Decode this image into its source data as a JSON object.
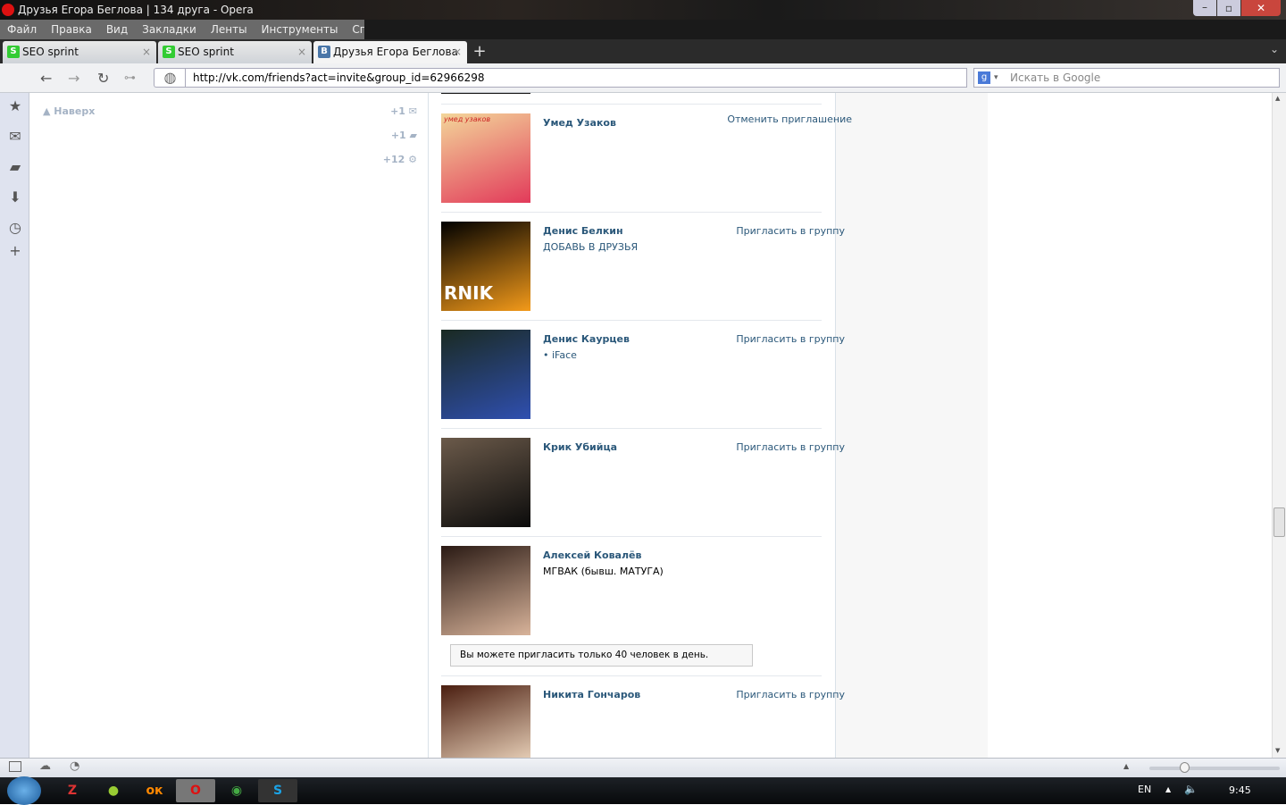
{
  "window": {
    "title": "Друзья Егора Беглова | 134 друга - Opera"
  },
  "menu": [
    "Файл",
    "Правка",
    "Вид",
    "Закладки",
    "Ленты",
    "Инструменты",
    "Справка"
  ],
  "tabs": [
    {
      "label": "SEO sprint"
    },
    {
      "label": "SEO sprint"
    },
    {
      "label": "Друзья Егора Беглова ..."
    }
  ],
  "address": {
    "url": "http://vk.com/friends?act=invite&group_id=62966298",
    "search_placeholder": "Искать в Google"
  },
  "left": {
    "up_label": "Наверх",
    "counters": [
      "+1",
      "+1",
      "+12"
    ]
  },
  "friends": [
    {
      "name": "Умед Узаков",
      "sub": "",
      "action": "Отменить приглашение",
      "photo_text": "умед узаков",
      "colors": [
        "#f3d69a",
        "#e23a5a"
      ]
    },
    {
      "name": "Денис Белкин",
      "sub": "ДОБАВЬ В ДРУЗЬЯ",
      "action": "Пригласить в группу",
      "photo_text": "RNIK",
      "colors": [
        "#000",
        "#f39a1a"
      ]
    },
    {
      "name": "Денис Каурцев",
      "sub": "• iFace",
      "action": "Пригласить в группу",
      "photo_text": "",
      "colors": [
        "#1a2a22",
        "#2f4fb0"
      ]
    },
    {
      "name": "Крик Убийца",
      "sub": "",
      "action": "Пригласить в группу",
      "photo_text": "",
      "colors": [
        "#6b5a4a",
        "#0b0b0b"
      ]
    },
    {
      "name": "Алексей Ковалёв",
      "sub": "МГВАК (бывш. МАТУГА)",
      "action": "",
      "photo_text": "",
      "colors": [
        "#2a1a14",
        "#d8b39a"
      ]
    },
    {
      "name": "Никита Гончаров",
      "sub": "",
      "action": "Пригласить в группу",
      "photo_text": "",
      "colors": [
        "#4a1e10",
        "#e8d0b8"
      ]
    }
  ],
  "notice": "Вы можете пригласить только 40 человек в день.",
  "tray": {
    "lang": "EN",
    "time": "9:45"
  }
}
